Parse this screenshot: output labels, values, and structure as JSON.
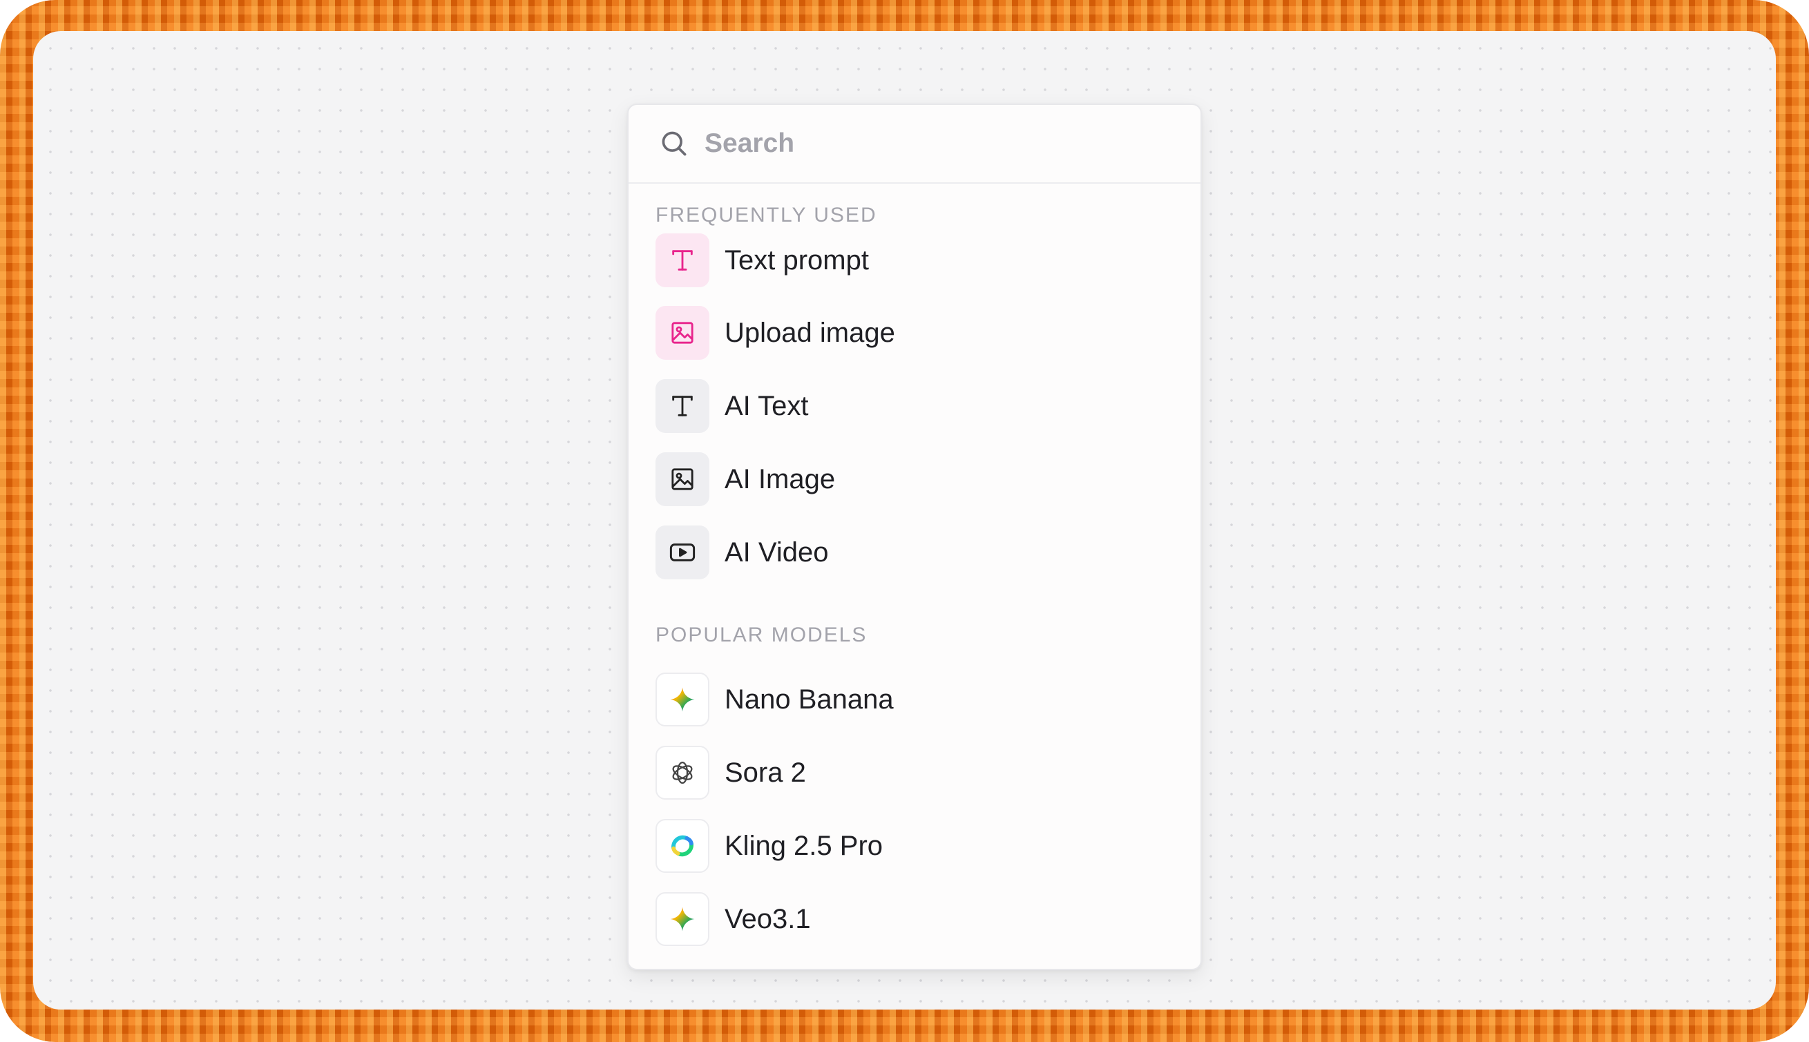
{
  "search": {
    "placeholder": "Search",
    "icon": "search-icon"
  },
  "sections": {
    "frequently_used": {
      "title": "FREQUENTLY USED",
      "items": [
        {
          "label": "Text prompt",
          "icon": "text-icon",
          "accent": "#e8248c"
        },
        {
          "label": "Upload image",
          "icon": "image-icon",
          "accent": "#e8248c"
        },
        {
          "label": "AI Text",
          "icon": "text-icon",
          "accent": "#222222"
        },
        {
          "label": "AI Image",
          "icon": "image-icon",
          "accent": "#222222"
        },
        {
          "label": "AI Video",
          "icon": "video-icon",
          "accent": "#222222"
        }
      ]
    },
    "popular_models": {
      "title": "POPULAR MODELS",
      "items": [
        {
          "label": "Nano Banana",
          "icon": "gemini-sparkle-icon"
        },
        {
          "label": "Sora 2",
          "icon": "openai-logo-icon"
        },
        {
          "label": "Kling 2.5 Pro",
          "icon": "kling-logo-icon"
        },
        {
          "label": "Veo3.1",
          "icon": "gemini-sparkle-icon"
        }
      ]
    }
  },
  "colors": {
    "frame": "#ef6f0c",
    "canvas": "#f4f4f5",
    "pink_accent": "#e8248c",
    "muted_text": "#a3a3ab"
  }
}
